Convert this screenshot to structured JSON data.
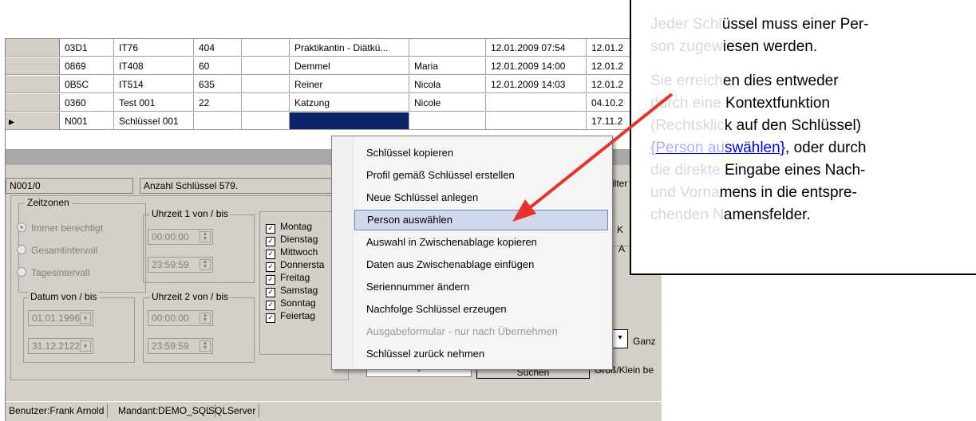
{
  "grid": {
    "rows": [
      {
        "c1": "03D1",
        "c2": "IT76",
        "c3": "404",
        "c4": "",
        "c5": "Praktikantin - Diätkü...",
        "c6": "",
        "c7": "12.01.2009 07:54",
        "c8": "12.01.2"
      },
      {
        "c1": "0869",
        "c2": "IT408",
        "c3": "60",
        "c4": "",
        "c5": "Demmel",
        "c6": "Maria",
        "c7": "12.01.2009 14:00",
        "c8": "12.01.2"
      },
      {
        "c1": "0B5C",
        "c2": "IT514",
        "c3": "635",
        "c4": "",
        "c5": "Reiner",
        "c6": "Nicola",
        "c7": "12.01.2009 14:03",
        "c8": "12.01.2"
      },
      {
        "c1": "0360",
        "c2": "Test 001",
        "c3": "22",
        "c4": "",
        "c5": "Katzung",
        "c6": "Nicole",
        "c7": "",
        "c8": "04.10.2"
      },
      {
        "c1": "N001",
        "c2": "Schlüssel 001",
        "c3": "",
        "c4": "",
        "c5": "",
        "c6": "",
        "c7": "",
        "c8": "17.11.2"
      }
    ],
    "current_row_marker": "▸"
  },
  "info": {
    "id": "N001/0",
    "count": "Anzahl Schlüssel 579."
  },
  "zeitzonen": {
    "title": "Zeitzonen",
    "options": [
      {
        "label": "Immer berechtigt",
        "checked": true
      },
      {
        "label": "Gesamtintervall",
        "checked": false
      },
      {
        "label": "Tagesintervall",
        "checked": false
      }
    ]
  },
  "uhrzeit1": {
    "title": "Uhrzeit 1 von / bis",
    "from": "00:00:00",
    "to": "23:59:59"
  },
  "uhrzeit2": {
    "title": "Uhrzeit 2 von / bis",
    "from": "00:00:00",
    "to": "23:59:59"
  },
  "datum": {
    "title": "Datum von / bis",
    "from": "01.01.1996",
    "to": "31.12.2122"
  },
  "days": [
    "Montag",
    "Dienstag",
    "Mittwoch",
    "Donnersta",
    "Freitag",
    "Samstag",
    "Sonntag",
    "Feiertag"
  ],
  "right_partial": {
    "filter": "ilter",
    "k": "K",
    "a": "A",
    "ganz": "Ganz",
    "gross": "Groß/Klein be",
    "suchen": "Suchen",
    "minus": "-"
  },
  "context_menu": {
    "items": [
      {
        "label": "Schlüssel kopieren",
        "highlighted": false,
        "disabled": false
      },
      {
        "label": "Profil gemäß Schlüssel erstellen",
        "highlighted": false,
        "disabled": false
      },
      {
        "label": "Neue Schlüssel anlegen",
        "highlighted": false,
        "disabled": false
      },
      {
        "label": "Person auswählen",
        "highlighted": true,
        "disabled": false
      },
      {
        "label": "Auswahl in Zwischenablage kopieren",
        "highlighted": false,
        "disabled": false
      },
      {
        "label": "Daten aus Zwischenablage einfügen",
        "highlighted": false,
        "disabled": false
      },
      {
        "label": "Seriennummer ändern",
        "highlighted": false,
        "disabled": false
      },
      {
        "label": "Nachfolge Schlüssel erzeugen",
        "highlighted": false,
        "disabled": false
      },
      {
        "label": "Ausgabeformular - nur nach Übernehmen",
        "highlighted": false,
        "disabled": true
      },
      {
        "label": "Schlüssel zurück nehmen",
        "highlighted": false,
        "disabled": false
      }
    ]
  },
  "status": {
    "user": "Benutzer:Frank Arnold",
    "mandant": "Mandant:DEMO_SQL",
    "server": "SQLServer"
  },
  "callout": {
    "p1a": "Jeder Schl",
    "p1b": "üssel muss einer Per-",
    "p1c": "son zugew",
    "p1d": "iesen werden.",
    "p2a": "Sie erreich",
    "p2b": "en dies entweder",
    "p2c": "durch eine ",
    "p2d": "Kontextfunktion",
    "p2e": "(Rechtsklic",
    "p2f": "k auf den Schlüssel)",
    "p2g": "{Person au",
    "p2h": "swählen}",
    "p2i": ", oder durch",
    "p2j": "die direkte ",
    "p2k": "Eingabe eines Nach-",
    "p2l": "und Vorna",
    "p2m": "mens in die entspre-",
    "p2n": "chenden N",
    "p2o": "amensfelder."
  },
  "colors": {
    "arrow": "#e8332a",
    "selection": "#0a246a",
    "menu_highlight": "#cfd8ec"
  }
}
